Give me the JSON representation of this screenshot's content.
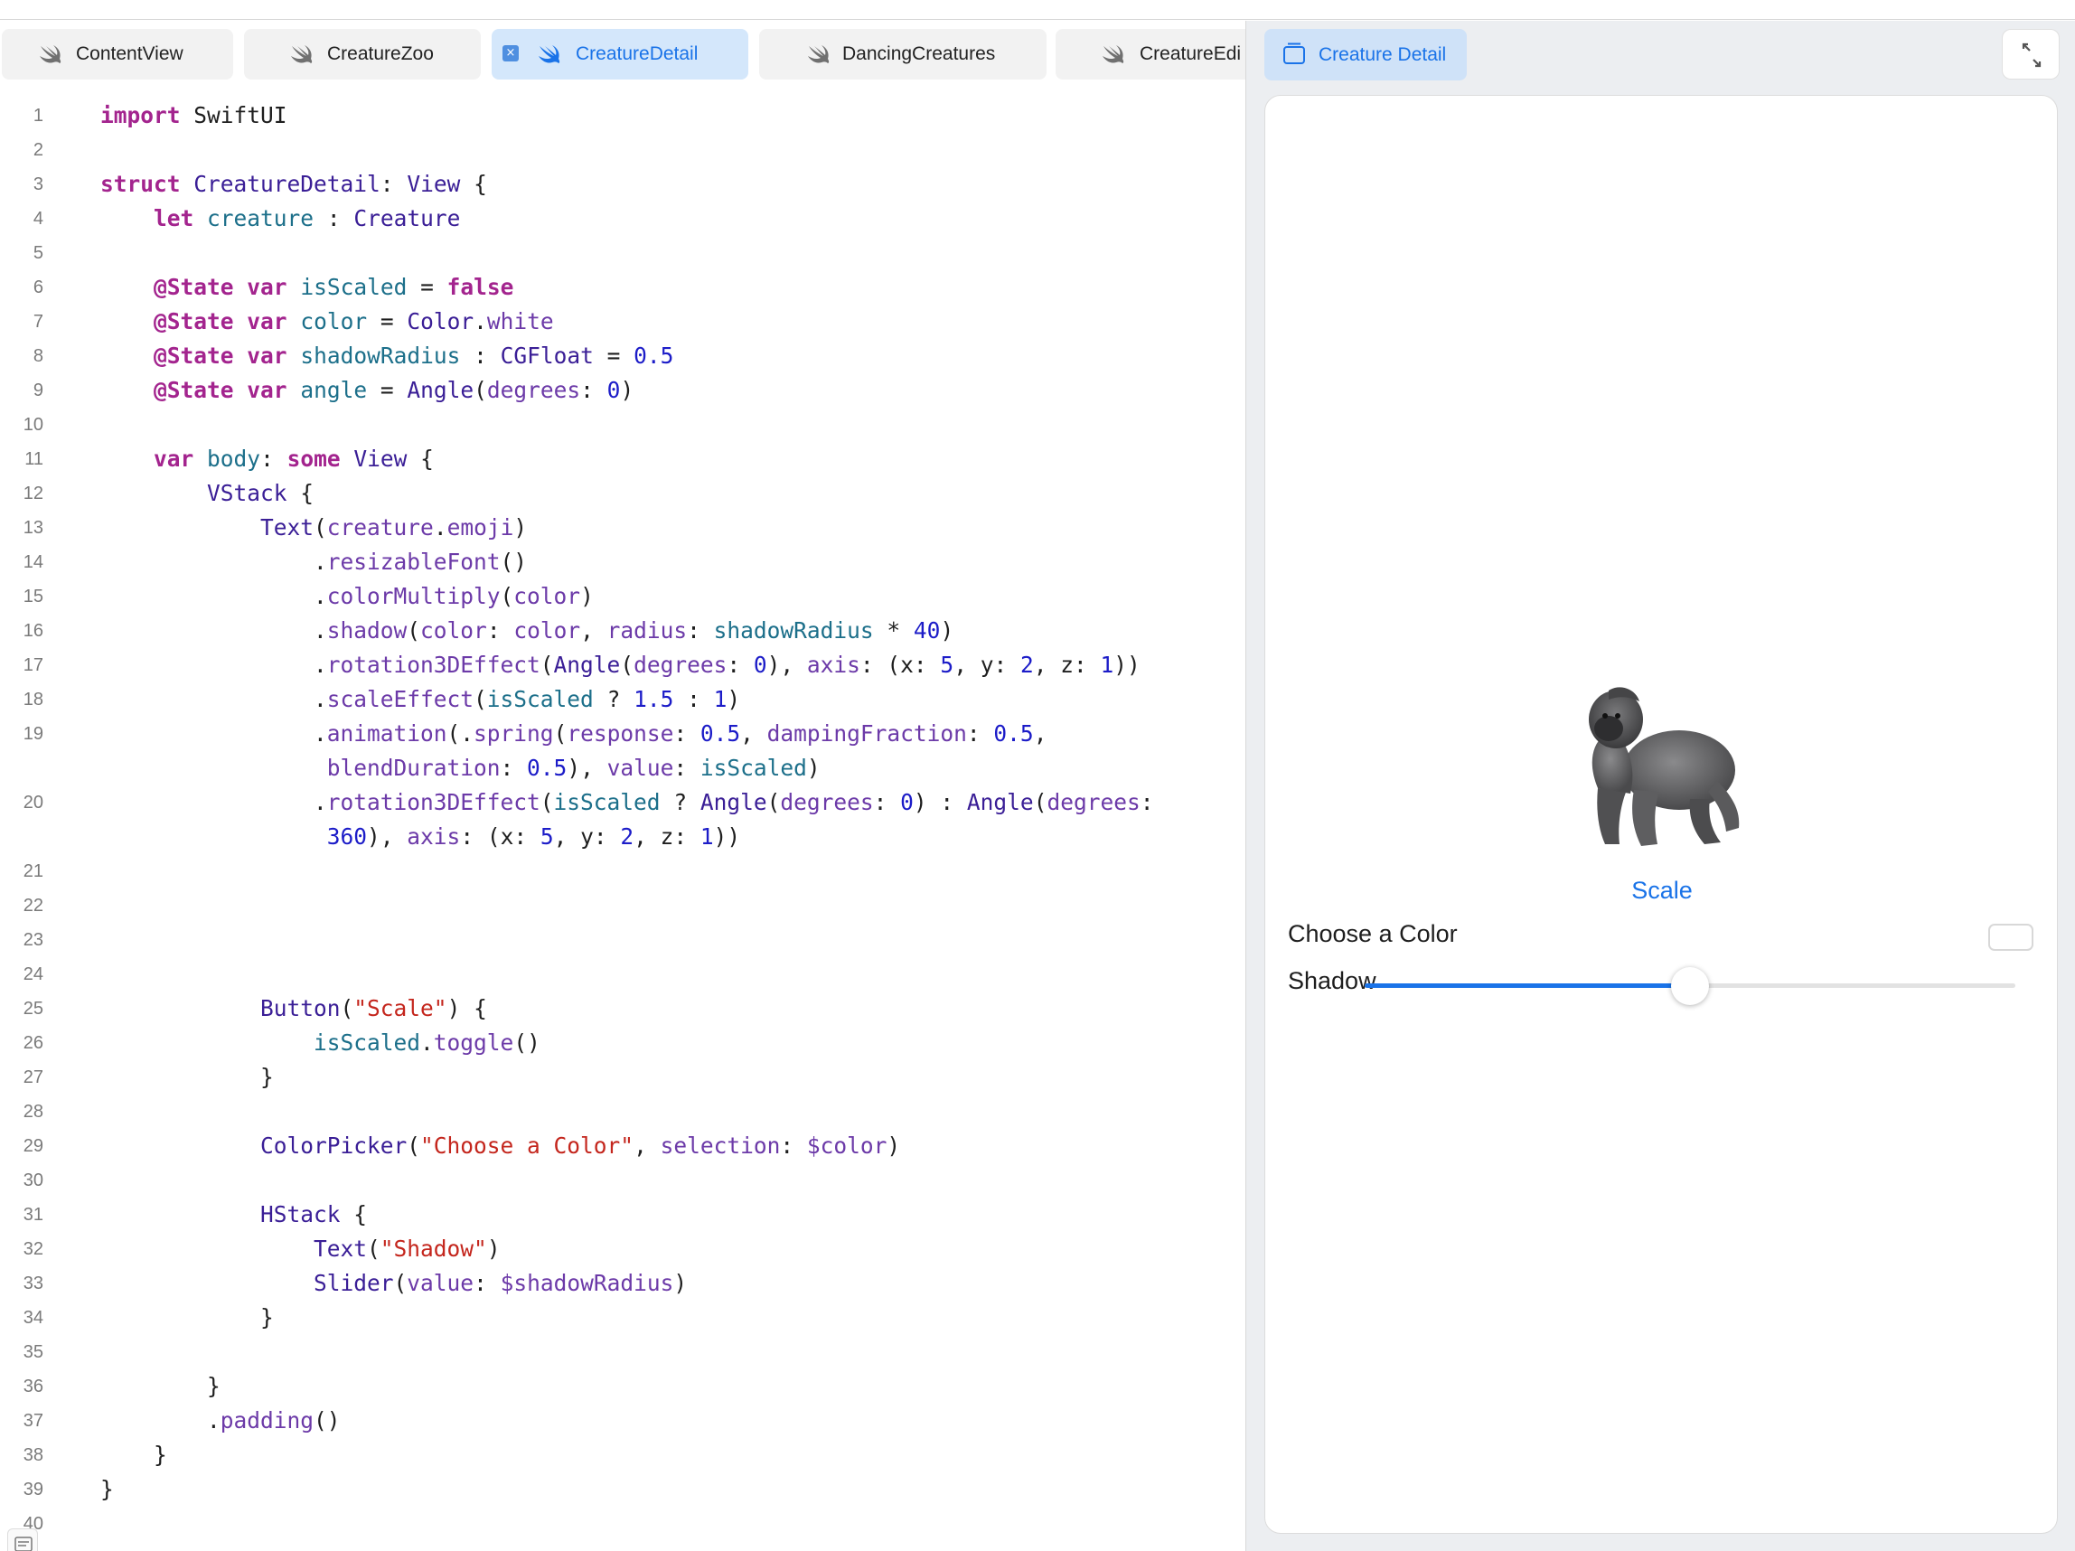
{
  "tabs": [
    {
      "label": "ContentView",
      "active": false
    },
    {
      "label": "CreatureZoo",
      "active": false
    },
    {
      "label": "CreatureDetail",
      "active": true
    },
    {
      "label": "DancingCreatures",
      "active": false
    },
    {
      "label": "CreatureEdi",
      "active": false
    }
  ],
  "colors": {
    "accent": "#1a73e8",
    "keyword": "#a3248e",
    "type": "#3a1e96",
    "identifier": "#1c6f8a",
    "method": "#6c3aa8",
    "number": "#1c1cc8",
    "string": "#c4261d"
  },
  "code": {
    "line_numbers": [
      "1",
      "2",
      "3",
      "4",
      "5",
      "6",
      "7",
      "8",
      "9",
      "10",
      "11",
      "12",
      "13",
      "14",
      "15",
      "16",
      "17",
      "18",
      "19",
      "",
      "20",
      "",
      "21",
      "22",
      "23",
      "24",
      "25",
      "26",
      "27",
      "28",
      "29",
      "30",
      "31",
      "32",
      "33",
      "34",
      "35",
      "36",
      "37",
      "38",
      "39",
      "40"
    ],
    "lines": [
      [
        [
          "kw",
          "import"
        ],
        [
          "pl",
          " SwiftUI"
        ]
      ],
      [],
      [
        [
          "kw",
          "struct"
        ],
        [
          "pl",
          " "
        ],
        [
          "ty",
          "CreatureDetail"
        ],
        [
          "pl",
          ": "
        ],
        [
          "ty",
          "View"
        ],
        [
          "pl",
          " {"
        ]
      ],
      [
        [
          "pl",
          "    "
        ],
        [
          "kw",
          "let"
        ],
        [
          "pl",
          " "
        ],
        [
          "id",
          "creature"
        ],
        [
          "pl",
          " : "
        ],
        [
          "ty",
          "Creature"
        ]
      ],
      [],
      [
        [
          "pl",
          "    "
        ],
        [
          "kw",
          "@State"
        ],
        [
          "pl",
          " "
        ],
        [
          "kw",
          "var"
        ],
        [
          "pl",
          " "
        ],
        [
          "id",
          "isScaled"
        ],
        [
          "pl",
          " = "
        ],
        [
          "kw",
          "false"
        ]
      ],
      [
        [
          "pl",
          "    "
        ],
        [
          "kw",
          "@State"
        ],
        [
          "pl",
          " "
        ],
        [
          "kw",
          "var"
        ],
        [
          "pl",
          " "
        ],
        [
          "id",
          "color"
        ],
        [
          "pl",
          " = "
        ],
        [
          "ty",
          "Color"
        ],
        [
          "pl",
          "."
        ],
        [
          "me",
          "white"
        ]
      ],
      [
        [
          "pl",
          "    "
        ],
        [
          "kw",
          "@State"
        ],
        [
          "pl",
          " "
        ],
        [
          "kw",
          "var"
        ],
        [
          "pl",
          " "
        ],
        [
          "id",
          "shadowRadius"
        ],
        [
          "pl",
          " : "
        ],
        [
          "ty",
          "CGFloat"
        ],
        [
          "pl",
          " = "
        ],
        [
          "nu",
          "0.5"
        ]
      ],
      [
        [
          "pl",
          "    "
        ],
        [
          "kw",
          "@State"
        ],
        [
          "pl",
          " "
        ],
        [
          "kw",
          "var"
        ],
        [
          "pl",
          " "
        ],
        [
          "id",
          "angle"
        ],
        [
          "pl",
          " = "
        ],
        [
          "ty",
          "Angle"
        ],
        [
          "pl",
          "("
        ],
        [
          "me",
          "degrees"
        ],
        [
          "pl",
          ": "
        ],
        [
          "nu",
          "0"
        ],
        [
          "pl",
          ")"
        ]
      ],
      [],
      [
        [
          "pl",
          "    "
        ],
        [
          "kw",
          "var"
        ],
        [
          "pl",
          " "
        ],
        [
          "id",
          "body"
        ],
        [
          "pl",
          ": "
        ],
        [
          "kw",
          "some"
        ],
        [
          "pl",
          " "
        ],
        [
          "ty",
          "View"
        ],
        [
          "pl",
          " {"
        ]
      ],
      [
        [
          "pl",
          "        "
        ],
        [
          "ty",
          "VStack"
        ],
        [
          "pl",
          " {"
        ]
      ],
      [
        [
          "pl",
          "            "
        ],
        [
          "ty",
          "Text"
        ],
        [
          "pl",
          "("
        ],
        [
          "me",
          "creature"
        ],
        [
          "pl",
          "."
        ],
        [
          "me",
          "emoji"
        ],
        [
          "pl",
          ")"
        ]
      ],
      [
        [
          "pl",
          "                ."
        ],
        [
          "me",
          "resizableFont"
        ],
        [
          "pl",
          "()"
        ]
      ],
      [
        [
          "pl",
          "                ."
        ],
        [
          "me",
          "colorMultiply"
        ],
        [
          "pl",
          "("
        ],
        [
          "me",
          "color"
        ],
        [
          "pl",
          ")"
        ]
      ],
      [
        [
          "pl",
          "                ."
        ],
        [
          "me",
          "shadow"
        ],
        [
          "pl",
          "("
        ],
        [
          "me",
          "color"
        ],
        [
          "pl",
          ": "
        ],
        [
          "me",
          "color"
        ],
        [
          "pl",
          ", "
        ],
        [
          "me",
          "radius"
        ],
        [
          "pl",
          ": "
        ],
        [
          "id",
          "shadowRadius"
        ],
        [
          "pl",
          " * "
        ],
        [
          "nu",
          "40"
        ],
        [
          "pl",
          ")"
        ]
      ],
      [
        [
          "pl",
          "                ."
        ],
        [
          "me",
          "rotation3DEffect"
        ],
        [
          "pl",
          "("
        ],
        [
          "ty",
          "Angle"
        ],
        [
          "pl",
          "("
        ],
        [
          "me",
          "degrees"
        ],
        [
          "pl",
          ": "
        ],
        [
          "nu",
          "0"
        ],
        [
          "pl",
          "), "
        ],
        [
          "me",
          "axis"
        ],
        [
          "pl",
          ": (x: "
        ],
        [
          "nu",
          "5"
        ],
        [
          "pl",
          ", y: "
        ],
        [
          "nu",
          "2"
        ],
        [
          "pl",
          ", z: "
        ],
        [
          "nu",
          "1"
        ],
        [
          "pl",
          "))"
        ]
      ],
      [
        [
          "pl",
          "                ."
        ],
        [
          "me",
          "scaleEffect"
        ],
        [
          "pl",
          "("
        ],
        [
          "id",
          "isScaled"
        ],
        [
          "pl",
          " ? "
        ],
        [
          "nu",
          "1.5"
        ],
        [
          "pl",
          " : "
        ],
        [
          "nu",
          "1"
        ],
        [
          "pl",
          ")"
        ]
      ],
      [
        [
          "pl",
          "                ."
        ],
        [
          "me",
          "animation"
        ],
        [
          "pl",
          "(."
        ],
        [
          "me",
          "spring"
        ],
        [
          "pl",
          "("
        ],
        [
          "me",
          "response"
        ],
        [
          "pl",
          ": "
        ],
        [
          "nu",
          "0.5"
        ],
        [
          "pl",
          ", "
        ],
        [
          "me",
          "dampingFraction"
        ],
        [
          "pl",
          ": "
        ],
        [
          "nu",
          "0.5"
        ],
        [
          "pl",
          ","
        ]
      ],
      [
        [
          "pl",
          "                 "
        ],
        [
          "me",
          "blendDuration"
        ],
        [
          "pl",
          ": "
        ],
        [
          "nu",
          "0.5"
        ],
        [
          "pl",
          "), "
        ],
        [
          "me",
          "value"
        ],
        [
          "pl",
          ": "
        ],
        [
          "id",
          "isScaled"
        ],
        [
          "pl",
          ")"
        ]
      ],
      [
        [
          "pl",
          "                ."
        ],
        [
          "me",
          "rotation3DEffect"
        ],
        [
          "pl",
          "("
        ],
        [
          "id",
          "isScaled"
        ],
        [
          "pl",
          " ? "
        ],
        [
          "ty",
          "Angle"
        ],
        [
          "pl",
          "("
        ],
        [
          "me",
          "degrees"
        ],
        [
          "pl",
          ": "
        ],
        [
          "nu",
          "0"
        ],
        [
          "pl",
          ") : "
        ],
        [
          "ty",
          "Angle"
        ],
        [
          "pl",
          "("
        ],
        [
          "me",
          "degrees"
        ],
        [
          "pl",
          ":"
        ]
      ],
      [
        [
          "pl",
          "                 "
        ],
        [
          "nu",
          "360"
        ],
        [
          "pl",
          "), "
        ],
        [
          "me",
          "axis"
        ],
        [
          "pl",
          ": (x: "
        ],
        [
          "nu",
          "5"
        ],
        [
          "pl",
          ", y: "
        ],
        [
          "nu",
          "2"
        ],
        [
          "pl",
          ", z: "
        ],
        [
          "nu",
          "1"
        ],
        [
          "pl",
          "))"
        ]
      ],
      [],
      [],
      [],
      [],
      [
        [
          "pl",
          "            "
        ],
        [
          "ty",
          "Button"
        ],
        [
          "pl",
          "("
        ],
        [
          "st",
          "\"Scale\""
        ],
        [
          "pl",
          ") {"
        ]
      ],
      [
        [
          "pl",
          "                "
        ],
        [
          "id",
          "isScaled"
        ],
        [
          "pl",
          "."
        ],
        [
          "me",
          "toggle"
        ],
        [
          "pl",
          "()"
        ]
      ],
      [
        [
          "pl",
          "            }"
        ]
      ],
      [],
      [
        [
          "pl",
          "            "
        ],
        [
          "ty",
          "ColorPicker"
        ],
        [
          "pl",
          "("
        ],
        [
          "st",
          "\"Choose a Color\""
        ],
        [
          "pl",
          ", "
        ],
        [
          "me",
          "selection"
        ],
        [
          "pl",
          ": "
        ],
        [
          "me",
          "$color"
        ],
        [
          "pl",
          ")"
        ]
      ],
      [],
      [
        [
          "pl",
          "            "
        ],
        [
          "ty",
          "HStack"
        ],
        [
          "pl",
          " {"
        ]
      ],
      [
        [
          "pl",
          "                "
        ],
        [
          "ty",
          "Text"
        ],
        [
          "pl",
          "("
        ],
        [
          "st",
          "\"Shadow\""
        ],
        [
          "pl",
          ")"
        ]
      ],
      [
        [
          "pl",
          "                "
        ],
        [
          "ty",
          "Slider"
        ],
        [
          "pl",
          "("
        ],
        [
          "me",
          "value"
        ],
        [
          "pl",
          ": "
        ],
        [
          "me",
          "$shadowRadius"
        ],
        [
          "pl",
          ")"
        ]
      ],
      [
        [
          "pl",
          "            }"
        ]
      ],
      [],
      [
        [
          "pl",
          "        }"
        ]
      ],
      [
        [
          "pl",
          "        ."
        ],
        [
          "me",
          "padding"
        ],
        [
          "pl",
          "()"
        ]
      ],
      [
        [
          "pl",
          "    }"
        ]
      ],
      [
        [
          "pl",
          "}"
        ]
      ],
      []
    ]
  },
  "preview": {
    "tab_label": "Creature Detail",
    "emoji_name": "gorilla-emoji",
    "scale_button": "Scale",
    "color_label": "Choose a Color",
    "shadow_label": "Shadow",
    "shadow_value": 0.5
  }
}
